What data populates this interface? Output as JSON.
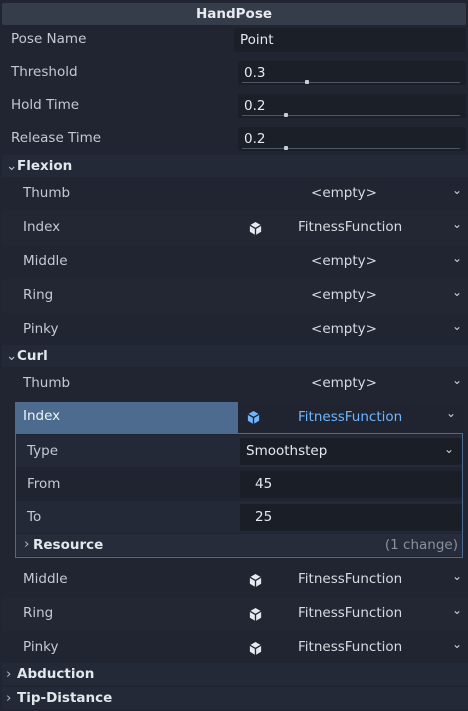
{
  "inspector": {
    "title": "HandPose",
    "props": {
      "pose_name": {
        "label": "Pose Name",
        "value": "Point"
      },
      "threshold": {
        "label": "Threshold",
        "value": "0.3",
        "level": 0.3
      },
      "hold_time": {
        "label": "Hold Time",
        "value": "0.2",
        "level": 0.2
      },
      "release_time": {
        "label": "Release Time",
        "value": "0.2",
        "level": 0.2
      }
    },
    "flexion": {
      "title": "Flexion",
      "rows": [
        {
          "label": "Thumb",
          "value": "<empty>"
        },
        {
          "label": "Index",
          "value": "FitnessFunction"
        },
        {
          "label": "Middle",
          "value": "<empty>"
        },
        {
          "label": "Ring",
          "value": "<empty>"
        },
        {
          "label": "Pinky",
          "value": "<empty>"
        }
      ]
    },
    "curl": {
      "title": "Curl",
      "thumb": {
        "label": "Thumb",
        "value": "<empty>"
      },
      "index": {
        "label": "Index",
        "value": "FitnessFunction"
      },
      "sub": {
        "type": {
          "label": "Type",
          "value": "Smoothstep"
        },
        "from": {
          "label": "From",
          "value": "45"
        },
        "to": {
          "label": "To",
          "value": "25"
        },
        "resource": {
          "label": "Resource",
          "changes": "(1 change)"
        }
      },
      "rows": [
        {
          "label": "Middle",
          "value": "FitnessFunction"
        },
        {
          "label": "Ring",
          "value": "FitnessFunction"
        },
        {
          "label": "Pinky",
          "value": "FitnessFunction"
        }
      ]
    },
    "abduction": {
      "title": "Abduction"
    },
    "tip_distance": {
      "title": "Tip-Distance"
    }
  },
  "icons": {
    "expanded": "chevron-down-icon",
    "collapsed": "chevron-right-icon",
    "dropdown": "chevron-down-icon",
    "resource": "cube-icon"
  },
  "colors": {
    "background": "#202531",
    "selection": "#4c6b8e",
    "accent_text": "#6fb6ff"
  }
}
